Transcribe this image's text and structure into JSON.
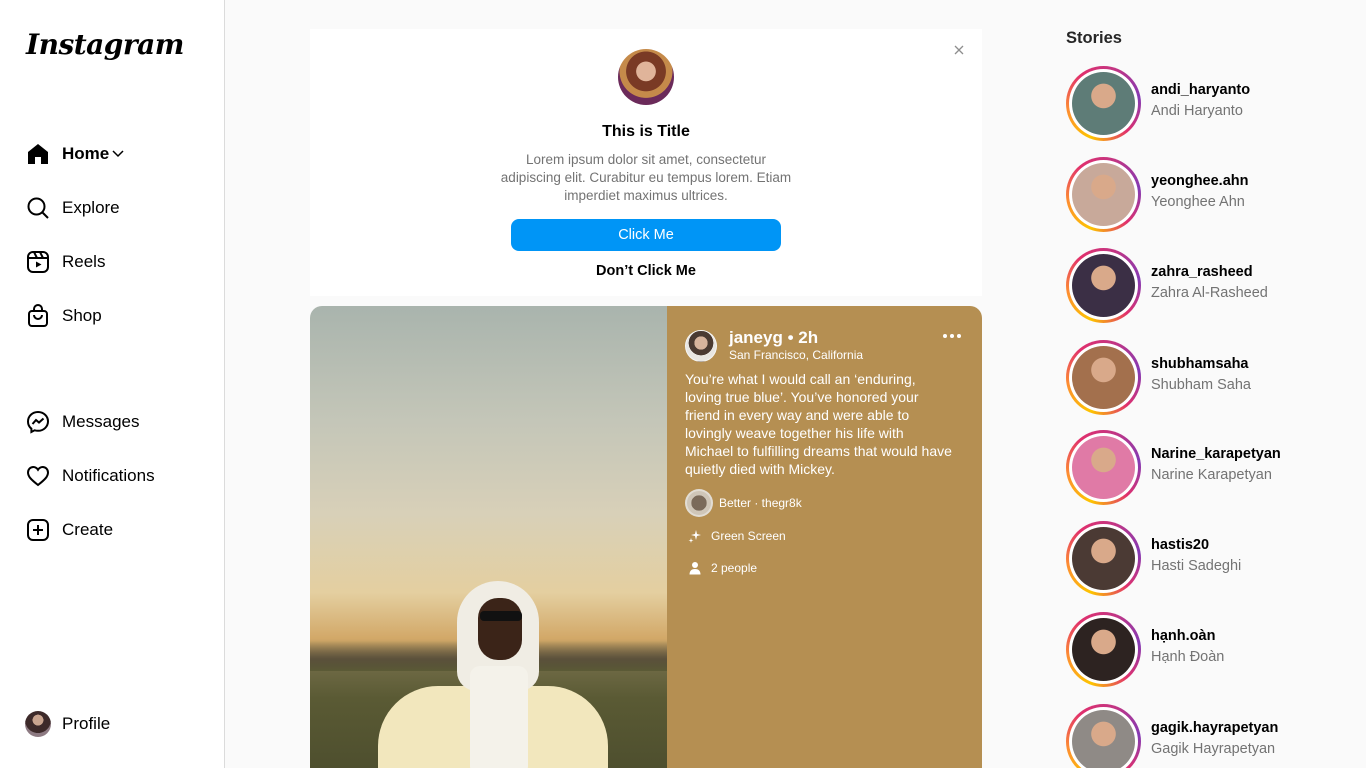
{
  "app": {
    "logo": "Instagram"
  },
  "nav": {
    "home": "Home",
    "explore": "Explore",
    "reels": "Reels",
    "shop": "Shop",
    "messages": "Messages",
    "notifications": "Notifications",
    "create": "Create",
    "profile": "Profile"
  },
  "card": {
    "title": "This is Title",
    "description": "Lorem ipsum dolor sit amet, consectetur adipiscing elit. Curabitur eu tempus lorem. Etiam imperdiet maximus ultrices.",
    "primary_button": "Click Me",
    "secondary_button": "Don’t Click Me"
  },
  "post": {
    "username": "janeyg",
    "time": "• 2h",
    "location": "San Francisco, California",
    "caption": "You’re what I would call an ‘enduring, loving true blue’. You’ve honored your friend in every way and were able to lovingly weave together his life with Michael to fulfilling dreams that would have quietly died with Mickey.",
    "audio": "Better · thegr8k",
    "effect": "Green Screen",
    "tagged": "2 people",
    "info_bg": "#b58f52"
  },
  "stories": {
    "title": "Stories",
    "items": [
      {
        "username": "andi_haryanto",
        "name": "Andi Haryanto",
        "photo": "#5e7c77"
      },
      {
        "username": "yeonghee.ahn",
        "name": "Yeonghee Ahn",
        "photo": "#c8a99a"
      },
      {
        "username": "zahra_rasheed",
        "name": "Zahra Al-Rasheed",
        "photo": "#3b2f45"
      },
      {
        "username": "shubhamsaha",
        "name": "Shubham Saha",
        "photo": "#a3704d"
      },
      {
        "username": "Narine_karapetyan",
        "name": "Narine Karapetyan",
        "photo": "#e07aa6"
      },
      {
        "username": "hastis20",
        "name": "Hasti Sadeghi",
        "photo": "#4b3a34"
      },
      {
        "username": "hạnh.oàn",
        "name": "Hạnh Đoàn",
        "photo": "#2d2321"
      },
      {
        "username": "gagik.hayrapetyan",
        "name": "Gagik Hayrapetyan",
        "photo": "#8f8a86"
      }
    ]
  },
  "colors": {
    "accent": "#0095f6",
    "text_secondary": "#737373"
  }
}
